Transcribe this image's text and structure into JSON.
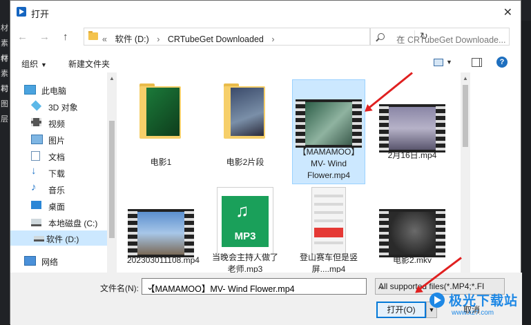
{
  "background_app": {
    "left_labels": [
      "材",
      "素材",
      "件",
      "素村",
      "司",
      "图层"
    ]
  },
  "dialog": {
    "title": "打开",
    "close_glyph": "✕",
    "nav": {
      "back": "←",
      "forward": "→",
      "up": "↑"
    },
    "address": {
      "prefix": "«",
      "crumbs": [
        "软件 (D:)",
        "CRTubeGet Downloaded"
      ],
      "separator": "›",
      "dropdown": "⌄",
      "refresh": "↻"
    },
    "search_placeholder": "在 CRTubeGet Downloade...",
    "toolbar": {
      "organize": "组织",
      "new_folder": "新建文件夹",
      "help": "?"
    },
    "sidebar": [
      {
        "label": "此电脑",
        "icon": "computer-icon"
      },
      {
        "label": "3D 对象",
        "icon": "3d-objects-icon"
      },
      {
        "label": "视频",
        "icon": "video-icon"
      },
      {
        "label": "图片",
        "icon": "picture-icon"
      },
      {
        "label": "文档",
        "icon": "document-icon"
      },
      {
        "label": "下载",
        "icon": "download-icon"
      },
      {
        "label": "音乐",
        "icon": "music-icon"
      },
      {
        "label": "桌面",
        "icon": "desktop-icon"
      },
      {
        "label": "本地磁盘 (C:)",
        "icon": "drive-icon"
      },
      {
        "label": "软件 (D:)",
        "icon": "drive-icon",
        "selected": true
      },
      {
        "label": "网络",
        "icon": "network-icon"
      }
    ],
    "files": [
      {
        "name": "电影1",
        "kind": "folder"
      },
      {
        "name": "电影2片段",
        "kind": "folder"
      },
      {
        "name": "【MAMAMOO】MV- Wind Flower.mp4",
        "kind": "video",
        "selected": true
      },
      {
        "name": "2月16日.mp4",
        "kind": "video"
      },
      {
        "name": "202303011108.mp4",
        "kind": "video"
      },
      {
        "name": "当晚会主持人做了老师.mp3",
        "kind": "audio",
        "badge": "MP3"
      },
      {
        "name": "登山赛车但是竖屏....mp4",
        "kind": "video-phone"
      },
      {
        "name": "电影2.mkv",
        "kind": "video"
      }
    ],
    "file_name_label": "文件名(N):",
    "file_name_value": "【MAMAMOO】MV- Wind Flower.mp4",
    "file_type_value": "All supported files(*.MP4;*.FI",
    "open_label": "打开(O)",
    "cancel_label": "取消"
  },
  "watermark": {
    "title": "极光下载站",
    "url": "www.xz7.com"
  },
  "colors": {
    "selection": "#cce8ff",
    "accent": "#0078d7",
    "arrow": "#e02020"
  }
}
